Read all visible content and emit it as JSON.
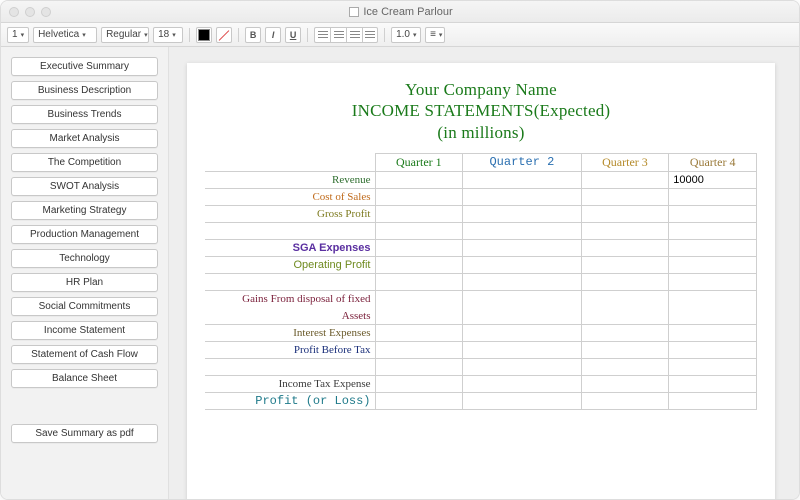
{
  "window": {
    "title": "Ice Cream Parlour"
  },
  "toolbar": {
    "style_level": "1",
    "font_family": "Helvetica",
    "font_style": "Regular",
    "font_size": "18",
    "line_spacing": "1.0",
    "bold": "B",
    "italic": "I",
    "underline": "U"
  },
  "sidebar": {
    "items": [
      {
        "label": "Executive Summary"
      },
      {
        "label": "Business Description"
      },
      {
        "label": "Business Trends"
      },
      {
        "label": "Market Analysis"
      },
      {
        "label": "The Competition"
      },
      {
        "label": "SWOT Analysis"
      },
      {
        "label": "Marketing Strategy"
      },
      {
        "label": "Production Management"
      },
      {
        "label": "Technology"
      },
      {
        "label": "HR Plan"
      },
      {
        "label": "Social Commitments"
      },
      {
        "label": "Income Statement"
      },
      {
        "label": "Statement of Cash Flow"
      },
      {
        "label": "Balance Sheet"
      }
    ],
    "save_label": "Save Summary as pdf"
  },
  "document": {
    "title_line1": "Your Company Name",
    "title_line2": "INCOME STATEMENTS(Expected)",
    "title_line3": "(in millions)",
    "headers": {
      "q1": "Quarter 1",
      "q2": "Quarter 2",
      "q3": "Quarter 3",
      "q4": "Quarter 4"
    },
    "rows": {
      "revenue": "Revenue",
      "cos": "Cost of Sales",
      "gp": "Gross Profit",
      "sga": "SGA Expenses",
      "op": "Operating Profit",
      "gain1": "Gains From disposal of fixed",
      "gain2": "Assets",
      "int": "Interest Expenses",
      "pbt": "Profit Before Tax",
      "ite": "Income Tax Expense",
      "pl": "Profit (or Loss)"
    },
    "values": {
      "revenue_q4": "10000"
    }
  }
}
